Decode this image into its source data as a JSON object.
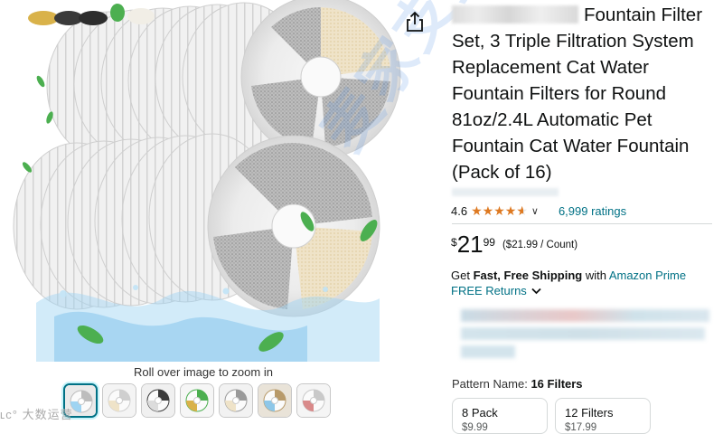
{
  "product": {
    "title": "Fountain Filter Set, 3 Triple Filtration System Replacement Cat Water Fountain Filters for Round 81oz/2.4L Automatic Pet Fountain Cat Water Fountain (Pack of 16)",
    "rating": "4.6",
    "stars_value": 4.6,
    "ratings_count": "6,999 ratings",
    "price_symbol": "$",
    "price_whole": "21",
    "price_fraction": "99",
    "per_unit": "($21.99 / Count)",
    "shipping_prefix": "Get ",
    "shipping_bold": "Fast, Free Shipping",
    "shipping_with": " with ",
    "prime_link": "Amazon Prime",
    "returns": "FREE Returns"
  },
  "image": {
    "zoom_hint": "Roll over image to zoom in",
    "watermark_center": "麦家支持",
    "watermark_bottom": "大数运营"
  },
  "thumbnails": [
    {
      "name": "filter-stack",
      "active": true
    },
    {
      "name": "filter-single"
    },
    {
      "name": "filter-layers"
    },
    {
      "name": "filter-materials"
    },
    {
      "name": "filter-diagram"
    },
    {
      "name": "fountain-in-use"
    },
    {
      "name": "filter-comparison"
    }
  ],
  "pattern": {
    "label": "Pattern Name:",
    "selected": "16 Filters",
    "options": [
      {
        "label": "8 Pack",
        "price": "$9.99"
      },
      {
        "label": "12 Filters",
        "price": "$17.99"
      }
    ]
  },
  "colors": {
    "link": "#007185",
    "star": "#de7921",
    "text": "#0f1111"
  }
}
